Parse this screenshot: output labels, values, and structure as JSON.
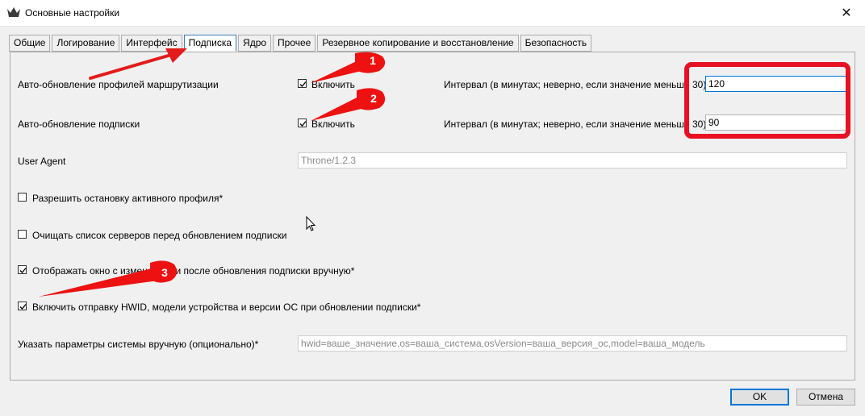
{
  "window": {
    "title": "Основные настройки",
    "close_glyph": "✕"
  },
  "tabs": [
    {
      "label": "Общие",
      "active": false
    },
    {
      "label": "Логирование",
      "active": false
    },
    {
      "label": "Интерфейс",
      "active": false
    },
    {
      "label": "Подписка",
      "active": true
    },
    {
      "label": "Ядро",
      "active": false
    },
    {
      "label": "Прочее",
      "active": false
    },
    {
      "label": "Резервное копирование и восстановление",
      "active": false
    },
    {
      "label": "Безопасность",
      "active": false
    }
  ],
  "settings": {
    "routing_update": {
      "label": "Авто-обновление профилей маршрутизации",
      "enable_label": "Включить",
      "enabled": true,
      "interval_label": "Интервал (в минутах; неверно, если значение меньше 30)",
      "interval_value": "120"
    },
    "subscription_update": {
      "label": "Авто-обновление подписки",
      "enable_label": "Включить",
      "enabled": true,
      "interval_label": "Интервал (в минутах; неверно, если значение меньше 30)",
      "interval_value": "90"
    },
    "user_agent": {
      "label": "User Agent",
      "placeholder": "Throne/1.2.3"
    },
    "allow_stop_active": {
      "label": "Разрешить остановку активного профиля*",
      "checked": false
    },
    "clear_servers": {
      "label": "Очищать список серверов перед обновлением подписки",
      "checked": false
    },
    "show_window": {
      "label": "Отображать окно с изменениями после обновления подписки вручную*",
      "checked": true
    },
    "send_hwid": {
      "label": "Включить отправку HWID, модели устройства и версии ОС при обновлении подписки*",
      "checked": true
    },
    "manual_params": {
      "label": "Указать параметры системы вручную (опционально)*",
      "placeholder": "hwid=ваше_значение,os=ваша_система,osVersion=ваша_версия_ос,model=ваша_модель"
    }
  },
  "buttons": {
    "ok": "OK",
    "cancel": "Отмена"
  },
  "annotations": {
    "markers": [
      "1",
      "2",
      "3"
    ],
    "arrow_color": "#ee1111",
    "highlight_color": "#e81123"
  }
}
